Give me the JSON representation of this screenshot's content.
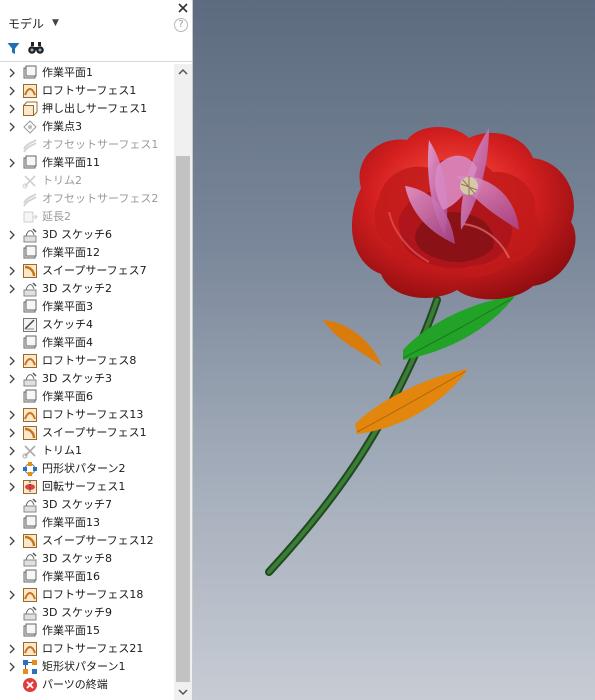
{
  "panel": {
    "title": "モデル",
    "help_glyph": "?"
  },
  "tree": [
    {
      "label": "作業平面1",
      "icon": "work-plane-icon",
      "expandable": true,
      "dim": false
    },
    {
      "label": "ロフトサーフェス1",
      "icon": "loft-surface-icon",
      "expandable": true,
      "dim": false
    },
    {
      "label": "押し出しサーフェス1",
      "icon": "extrude-surface-icon",
      "expandable": true,
      "dim": false
    },
    {
      "label": "作業点3",
      "icon": "work-point-icon",
      "expandable": true,
      "dim": false
    },
    {
      "label": "オフセットサーフェス1",
      "icon": "offset-surface-icon",
      "expandable": false,
      "dim": true
    },
    {
      "label": "作業平面11",
      "icon": "work-plane-icon",
      "expandable": true,
      "dim": false
    },
    {
      "label": "トリム2",
      "icon": "trim-icon",
      "expandable": false,
      "dim": true
    },
    {
      "label": "オフセットサーフェス2",
      "icon": "offset-surface-icon",
      "expandable": false,
      "dim": true
    },
    {
      "label": "延長2",
      "icon": "extend-icon",
      "expandable": false,
      "dim": true
    },
    {
      "label": "3D スケッチ6",
      "icon": "3d-sketch-icon",
      "expandable": true,
      "dim": false
    },
    {
      "label": "作業平面12",
      "icon": "work-plane-icon",
      "expandable": false,
      "dim": false
    },
    {
      "label": "スイープサーフェス7",
      "icon": "sweep-surface-icon",
      "expandable": true,
      "dim": false
    },
    {
      "label": "3D スケッチ2",
      "icon": "3d-sketch-icon",
      "expandable": true,
      "dim": false
    },
    {
      "label": "作業平面3",
      "icon": "work-plane-icon",
      "expandable": false,
      "dim": false
    },
    {
      "label": "スケッチ4",
      "icon": "sketch-icon",
      "expandable": false,
      "dim": false
    },
    {
      "label": "作業平面4",
      "icon": "work-plane-icon",
      "expandable": false,
      "dim": false
    },
    {
      "label": "ロフトサーフェス8",
      "icon": "loft-surface-icon",
      "expandable": true,
      "dim": false
    },
    {
      "label": "3D スケッチ3",
      "icon": "3d-sketch-icon",
      "expandable": true,
      "dim": false
    },
    {
      "label": "作業平面6",
      "icon": "work-plane-icon",
      "expandable": false,
      "dim": false
    },
    {
      "label": "ロフトサーフェス13",
      "icon": "loft-surface-icon",
      "expandable": true,
      "dim": false
    },
    {
      "label": "スイープサーフェス1",
      "icon": "sweep-surface-icon",
      "expandable": true,
      "dim": false
    },
    {
      "label": "トリム1",
      "icon": "trim-icon",
      "expandable": true,
      "dim": false
    },
    {
      "label": "円形状パターン2",
      "icon": "circular-pattern-icon",
      "expandable": true,
      "dim": false
    },
    {
      "label": "回転サーフェス1",
      "icon": "revolve-surface-icon",
      "expandable": true,
      "dim": false
    },
    {
      "label": "3D スケッチ7",
      "icon": "3d-sketch-icon",
      "expandable": false,
      "dim": false
    },
    {
      "label": "作業平面13",
      "icon": "work-plane-icon",
      "expandable": false,
      "dim": false
    },
    {
      "label": "スイープサーフェス12",
      "icon": "sweep-surface-icon",
      "expandable": true,
      "dim": false
    },
    {
      "label": "3D スケッチ8",
      "icon": "3d-sketch-icon",
      "expandable": false,
      "dim": false
    },
    {
      "label": "作業平面16",
      "icon": "work-plane-icon",
      "expandable": false,
      "dim": false
    },
    {
      "label": "ロフトサーフェス18",
      "icon": "loft-surface-icon",
      "expandable": true,
      "dim": false
    },
    {
      "label": "3D スケッチ9",
      "icon": "3d-sketch-icon",
      "expandable": false,
      "dim": false
    },
    {
      "label": "作業平面15",
      "icon": "work-plane-icon",
      "expandable": false,
      "dim": false
    },
    {
      "label": "ロフトサーフェス21",
      "icon": "loft-surface-icon",
      "expandable": true,
      "dim": false
    },
    {
      "label": "矩形状パターン1",
      "icon": "rectangular-pattern-icon",
      "expandable": true,
      "dim": false
    },
    {
      "label": "パーツの終端",
      "icon": "end-of-part-icon",
      "expandable": false,
      "dim": false
    }
  ],
  "colors": {
    "petal": "#d41f1f",
    "inner_petal": "#c86ab0",
    "stem": "#2e6b2c",
    "green_leaf": "#22a327",
    "orange_leaf": "#e2860d"
  }
}
